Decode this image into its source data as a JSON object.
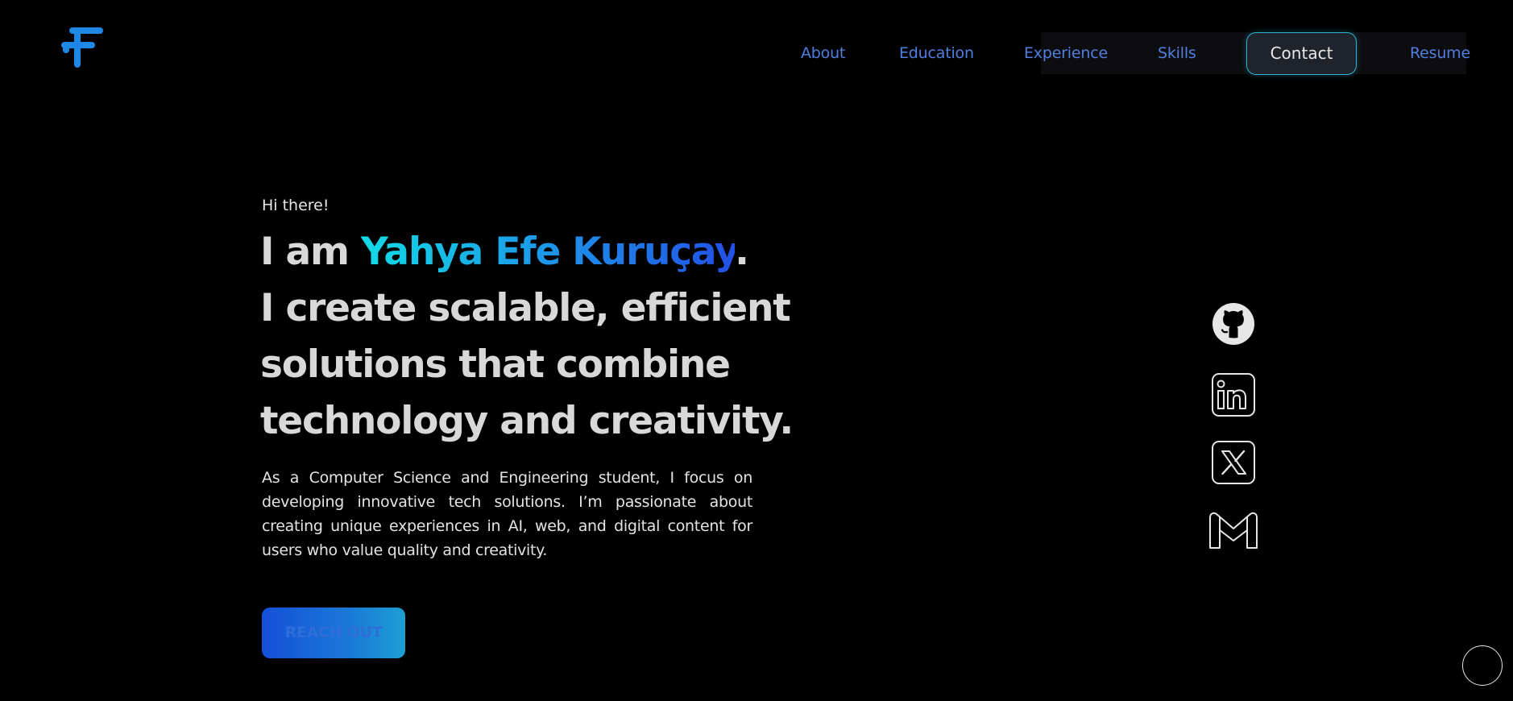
{
  "nav": {
    "about": "About",
    "education": "Education",
    "experience": "Experience",
    "skills": "Skills",
    "contact": "Contact",
    "resume": "Resume"
  },
  "hero": {
    "greeting": "Hi there!",
    "headline_prefix": "I am ",
    "name": "Yahya Efe Kuruçay",
    "headline_period": ".",
    "headline_line2": "I create scalable, efficient",
    "headline_line3": "solutions that combine",
    "headline_line4": "technology and creativity.",
    "intro": "As a Computer Science and Engineering student, I focus on developing innovative tech solutions. I’m passionate about creating unique experiences in AI, web, and digital content for users who value quality and creativity.",
    "cta": "REACH OUT"
  },
  "socials": [
    {
      "icon": "github-icon"
    },
    {
      "icon": "linkedin-icon"
    },
    {
      "icon": "x-twitter-icon"
    },
    {
      "icon": "gmail-icon"
    }
  ],
  "colors": {
    "background": "#000000",
    "nav_link": "#4f7fe0",
    "accent_cyan": "#12dbe6",
    "accent_blue": "#2250e6",
    "logo": "#1e88e5"
  }
}
